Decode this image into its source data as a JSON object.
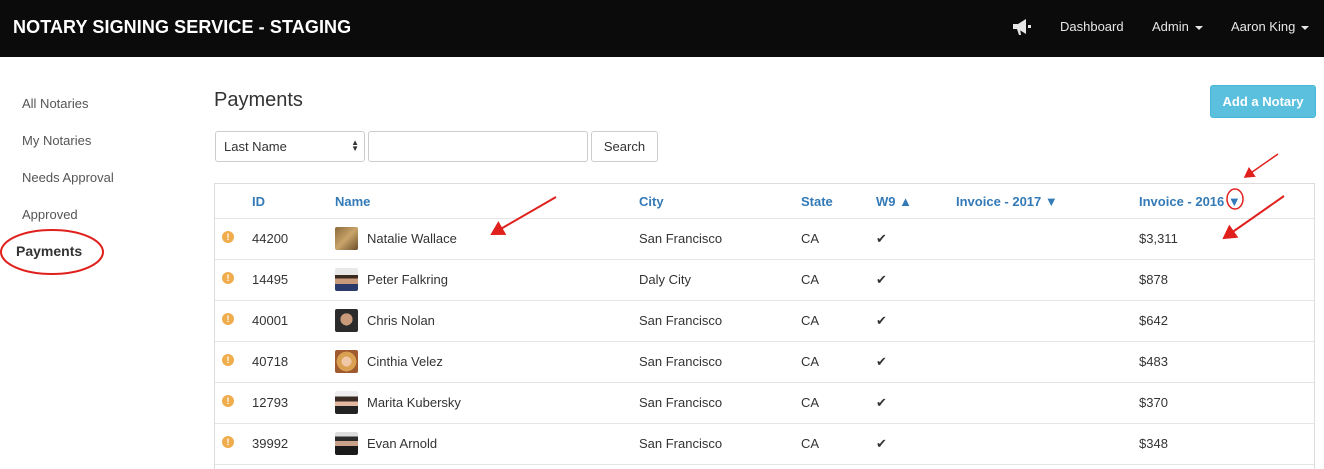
{
  "app": {
    "title": "NOTARY SIGNING SERVICE - STAGING",
    "nav": {
      "dashboard": "Dashboard",
      "admin": "Admin",
      "user": "Aaron King"
    }
  },
  "sidebar": {
    "items": [
      {
        "label": "All Notaries"
      },
      {
        "label": "My Notaries"
      },
      {
        "label": "Needs Approval"
      },
      {
        "label": "Approved"
      },
      {
        "label": "Payments",
        "active": true
      }
    ]
  },
  "main": {
    "title": "Payments",
    "add_button": "Add a Notary",
    "search": {
      "select_value": "Last Name",
      "input_value": "",
      "button": "Search"
    },
    "table": {
      "headers": {
        "id": "ID",
        "name": "Name",
        "city": "City",
        "state": "State",
        "w9": "W9 ▲",
        "invoice_2017": "Invoice - 2017 ▼",
        "invoice_2016": "Invoice - 2016"
      },
      "sort_indicator": "▼",
      "rows": [
        {
          "id": "44200",
          "name": "Natalie Wallace",
          "city": "San Francisco",
          "state": "CA",
          "w9": "✔",
          "invoice_2016": "$3,311"
        },
        {
          "id": "14495",
          "name": "Peter Falkring",
          "city": "Daly City",
          "state": "CA",
          "w9": "✔",
          "invoice_2016": "$878"
        },
        {
          "id": "40001",
          "name": "Chris Nolan",
          "city": "San Francisco",
          "state": "CA",
          "w9": "✔",
          "invoice_2016": "$642"
        },
        {
          "id": "40718",
          "name": "Cinthia Velez",
          "city": "San Francisco",
          "state": "CA",
          "w9": "✔",
          "invoice_2016": "$483"
        },
        {
          "id": "12793",
          "name": "Marita Kubersky",
          "city": "San Francisco",
          "state": "CA",
          "w9": "✔",
          "invoice_2016": "$370"
        },
        {
          "id": "39992",
          "name": "Evan Arnold",
          "city": "San Francisco",
          "state": "CA",
          "w9": "✔",
          "invoice_2016": "$348"
        }
      ]
    }
  },
  "colors": {
    "navbar": "#0b0b0b",
    "link": "#337ab7",
    "accent_button": "#5bc0de",
    "warning": "#f0ad4e",
    "annotation": "#e0201c"
  },
  "icons": {
    "nav": "megaphone-icon",
    "row_status": "exclamation-circle-icon",
    "w9": "checkmark-icon"
  }
}
